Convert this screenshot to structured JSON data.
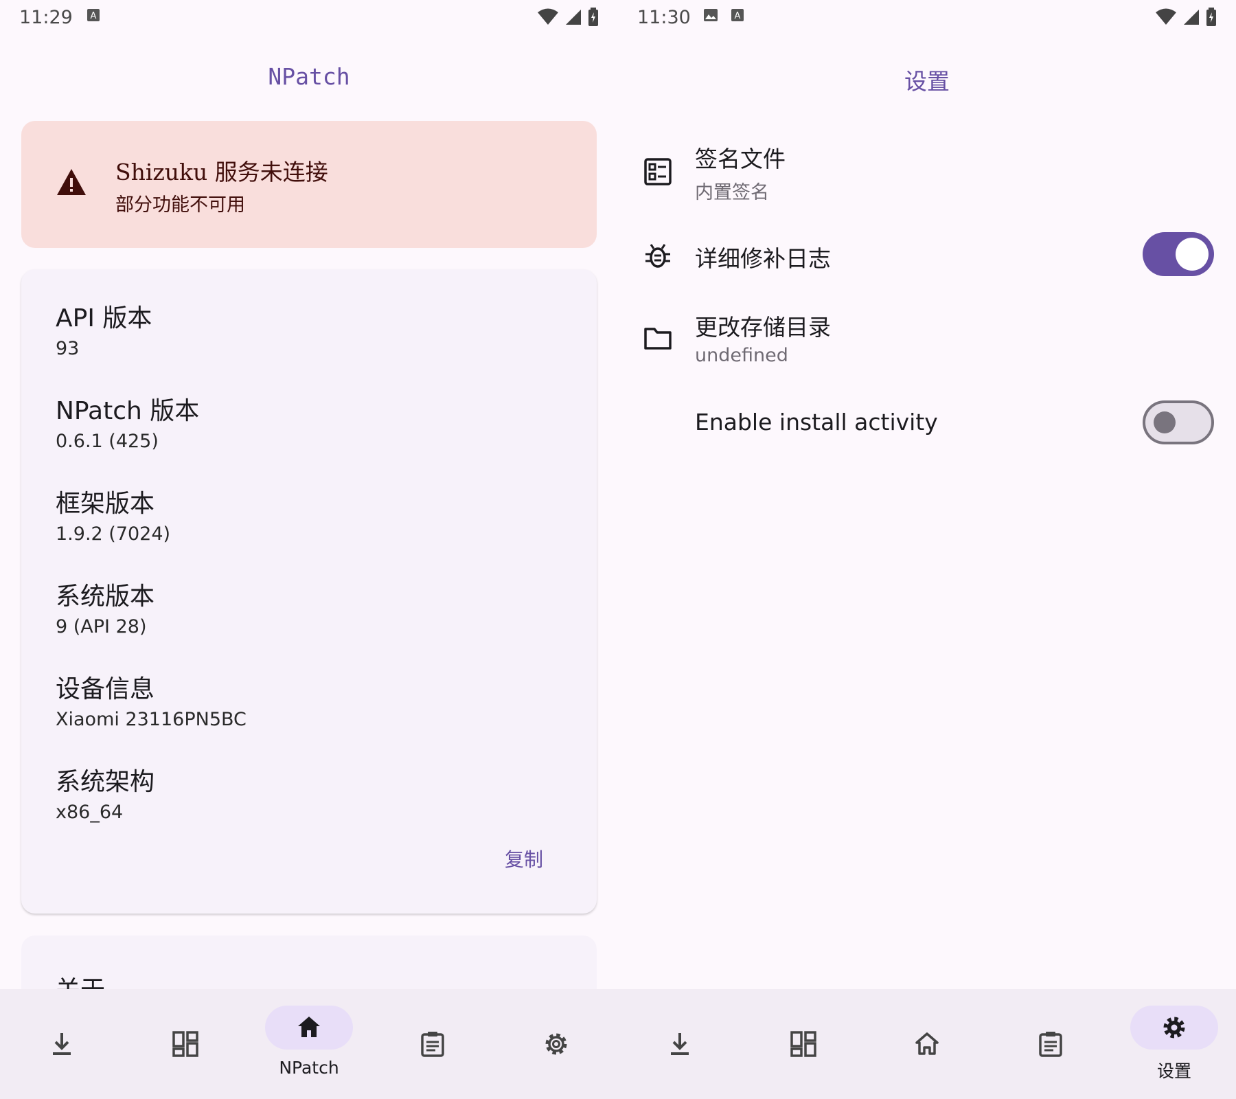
{
  "colors": {
    "primary": "#6750A4",
    "background": "#FDF8FD",
    "error_container": "#F9DEDC",
    "card": "#F7F2FA",
    "nav_bar": "#F2ECF4",
    "nav_indicator": "#E8DEF8"
  },
  "left": {
    "status": {
      "time": "11:29"
    },
    "title": "NPatch",
    "warning": {
      "icon": "warning-icon",
      "title": "Shizuku 服务未连接",
      "subtitle": "部分功能不可用"
    },
    "info": {
      "items": [
        {
          "label": "API 版本",
          "value": "93"
        },
        {
          "label": "NPatch 版本",
          "value": "0.6.1 (425)"
        },
        {
          "label": "框架版本",
          "value": "1.9.2 (7024)"
        },
        {
          "label": "系统版本",
          "value": "9 (API 28)"
        },
        {
          "label": "设备信息",
          "value": "Xiaomi 23116PN5BC"
        },
        {
          "label": "系统架构",
          "value": "x86_64"
        }
      ],
      "copy_label": "复制"
    },
    "about_label": "关于",
    "nav": {
      "items": [
        {
          "icon": "download-icon",
          "label": ""
        },
        {
          "icon": "apps-grid-icon",
          "label": ""
        },
        {
          "icon": "home-icon",
          "label": "NPatch",
          "active": true
        },
        {
          "icon": "clipboard-icon",
          "label": ""
        },
        {
          "icon": "gear-icon",
          "label": ""
        }
      ]
    }
  },
  "right": {
    "status": {
      "time": "11:30"
    },
    "title": "设置",
    "settings": [
      {
        "icon": "signature-file-icon",
        "title": "签名文件",
        "subtitle": "内置签名"
      },
      {
        "icon": "bug-icon",
        "title": "详细修补日志",
        "switch": true
      },
      {
        "icon": "folder-icon",
        "title": "更改存储目录",
        "subtitle": "undefined"
      },
      {
        "icon": "",
        "title": "Enable install activity",
        "switch": false
      }
    ],
    "nav": {
      "items": [
        {
          "icon": "download-icon",
          "label": ""
        },
        {
          "icon": "apps-grid-icon",
          "label": ""
        },
        {
          "icon": "home-outline-icon",
          "label": ""
        },
        {
          "icon": "clipboard-icon",
          "label": ""
        },
        {
          "icon": "gear-icon",
          "label": "设置",
          "active": true
        }
      ]
    }
  }
}
